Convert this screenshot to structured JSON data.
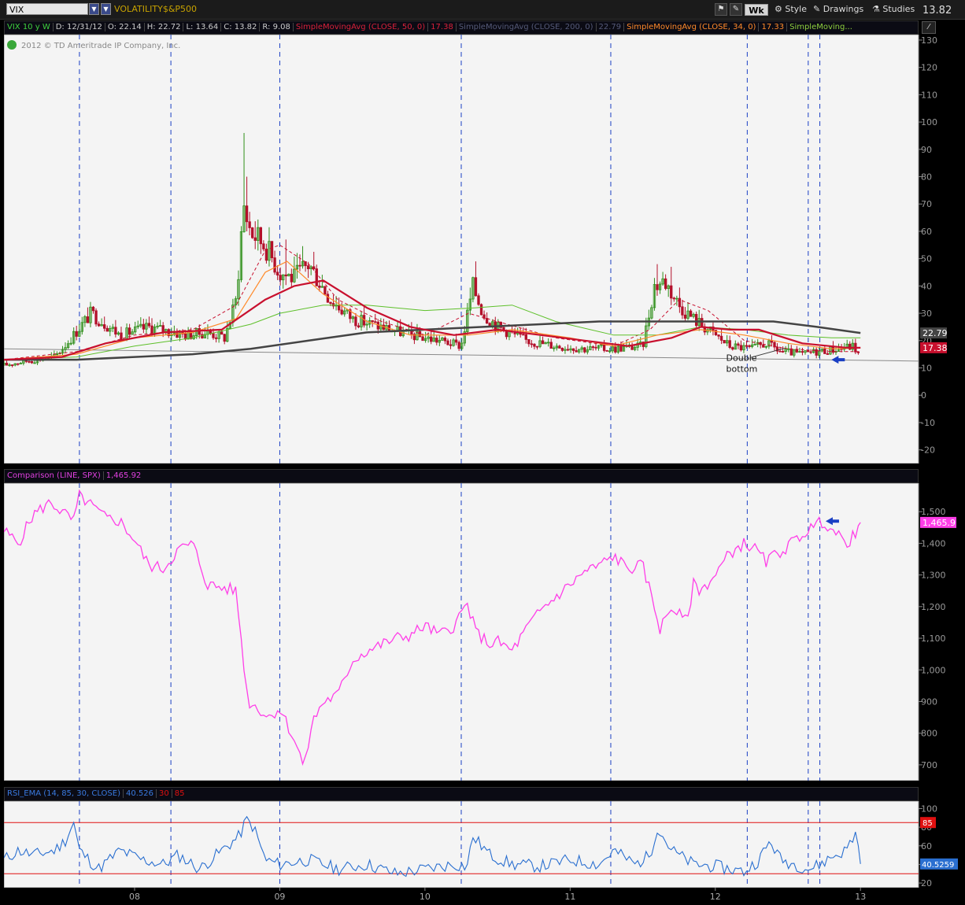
{
  "toolbar": {
    "symbol": "VIX",
    "title": "VOLATILITY$&P500",
    "timeframe": "Wk",
    "style_label": "Style",
    "drawings_label": "Drawings",
    "studies_label": "Studies",
    "last_price": "13.82"
  },
  "info": {
    "symbol_period": "VIX 10 y W",
    "date": "D: 12/31/12",
    "open": "O: 22.14",
    "high": "H: 22.72",
    "low": "L: 13.64",
    "close": "C: 13.82",
    "range": "R: 9.08",
    "sma50_label": "SimpleMovingAvg (CLOSE, 50, 0)",
    "sma50_val": "17.38",
    "sma200_label": "SimpleMovingAvg (CLOSE, 200, 0)",
    "sma200_val": "22.79",
    "sma34_label": "SimpleMovingAvg (CLOSE, 34, 0)",
    "sma34_val": "17.33",
    "sma_more_label": "SimpleMoving...",
    "copyright": "2012 © TD Ameritrade IP Company, Inc."
  },
  "colors": {
    "background": "#000000",
    "pane_bg": "#f4f4f4",
    "grid_vertical": "#1a3fc4",
    "candle_up": "#2f8f1a",
    "candle_down": "#b3102a",
    "sma50": "#c8102e",
    "sma200": "#444444",
    "sma34": "#ff8a2a",
    "sma_green": "#5ec02a",
    "spx_line": "#ff3ee8",
    "rsi_line": "#2a6fd0",
    "rsi_levels": "#e01010"
  },
  "chart_data": [
    {
      "type": "candlestick",
      "title": "VIX 10 y W",
      "ylim": [
        -25,
        132
      ],
      "yticks": [
        -20,
        -10,
        0,
        10,
        20,
        30,
        40,
        50,
        60,
        70,
        80,
        90,
        100,
        110,
        120,
        130
      ],
      "xlim": [
        2007.1,
        2013.4
      ],
      "xticks": [
        2008,
        2009,
        2010,
        2011,
        2012,
        2013
      ],
      "xtick_labels": [
        "08",
        "09",
        "10",
        "11",
        "12",
        "13"
      ],
      "vertical_lines": [
        2007.62,
        2008.25,
        2009.0,
        2010.25,
        2011.28,
        2012.22,
        2012.64,
        2012.72
      ],
      "last_labels": [
        {
          "value": 22.79,
          "text": "22.79",
          "color": "#444444"
        },
        {
          "value": 17.38,
          "text": "17.38",
          "color": "#c8102e"
        }
      ],
      "annotation": {
        "text_line1": "Double",
        "text_line2": "bottom",
        "x": 2012.4,
        "y": 12
      },
      "arrow": {
        "x": 2012.8,
        "y": 13
      },
      "trendline": {
        "x": [
          2007.1,
          2013.4
        ],
        "y": [
          17.0,
          12.5
        ]
      },
      "series_anchors": {
        "close": {
          "x": [
            2007.1,
            2007.25,
            2007.45,
            2007.55,
            2007.7,
            2007.9,
            2008.1,
            2008.35,
            2008.5,
            2008.62,
            2008.7,
            2008.75,
            2008.8,
            2008.9,
            2009.0,
            2009.1,
            2009.2,
            2009.35,
            2009.5,
            2009.7,
            2009.9,
            2010.1,
            2010.25,
            2010.33,
            2010.4,
            2010.5,
            2010.7,
            2010.9,
            2011.1,
            2011.3,
            2011.5,
            2011.58,
            2011.65,
            2011.75,
            2011.85,
            2011.95,
            2012.1,
            2012.25,
            2012.35,
            2012.45,
            2012.6,
            2012.7,
            2012.85,
            2012.95,
            2013.0
          ],
          "y": [
            11,
            12.5,
            14,
            20,
            30,
            22,
            25,
            22,
            23,
            21,
            35,
            70,
            60,
            55,
            45,
            43,
            48,
            35,
            28,
            25,
            22,
            20,
            18,
            40,
            30,
            25,
            20,
            18,
            17,
            17,
            18,
            40,
            42,
            33,
            28,
            24,
            18,
            17,
            19,
            16,
            15,
            16,
            17,
            18,
            14
          ]
        },
        "high": {
          "x": [
            2008.75,
            2008.77,
            2009.05,
            2010.35,
            2011.6,
            2011.7
          ],
          "y": [
            96,
            80,
            57,
            49,
            48,
            47
          ]
        },
        "sma50": {
          "x": [
            2007.1,
            2007.5,
            2007.8,
            2008.2,
            2008.6,
            2008.9,
            2009.1,
            2009.3,
            2009.6,
            2009.9,
            2010.2,
            2010.5,
            2010.8,
            2011.1,
            2011.4,
            2011.7,
            2011.9,
            2012.1,
            2012.3,
            2012.6,
            2012.9,
            2013.0
          ],
          "y": [
            13,
            14,
            19,
            23,
            24,
            35,
            40,
            42,
            32,
            25,
            22,
            24,
            22,
            20,
            18,
            21,
            25,
            24,
            24,
            19,
            17.4,
            17.38
          ]
        },
        "sma200": {
          "x": [
            2007.1,
            2007.6,
            2008.0,
            2008.4,
            2008.8,
            2009.2,
            2009.6,
            2010.0,
            2010.4,
            2010.8,
            2011.2,
            2011.6,
            2012.0,
            2012.4,
            2012.7,
            2013.0
          ],
          "y": [
            13,
            13,
            14,
            15,
            17,
            20,
            23,
            24,
            25,
            26,
            27,
            27,
            27,
            27,
            25,
            22.79
          ]
        },
        "sma34": {
          "x": [
            2007.1,
            2007.6,
            2008.0,
            2008.4,
            2008.7,
            2008.9,
            2009.05,
            2009.3,
            2009.6,
            2009.9,
            2010.3,
            2010.6,
            2011.0,
            2011.3,
            2011.6,
            2011.9,
            2012.2,
            2012.5,
            2012.8,
            2013.0
          ],
          "y": [
            13,
            15,
            21,
            23,
            28,
            45,
            49,
            37,
            27,
            22,
            22,
            24,
            21,
            18,
            22,
            24,
            22,
            19,
            17,
            17.33
          ]
        },
        "sma_green": {
          "x": [
            2007.1,
            2007.6,
            2008.0,
            2008.4,
            2008.8,
            2009.0,
            2009.3,
            2009.6,
            2010.0,
            2010.35,
            2010.6,
            2010.9,
            2011.3,
            2011.6,
            2011.9,
            2012.2,
            2012.5,
            2012.8,
            2013.0
          ],
          "y": [
            13,
            14,
            18,
            21,
            26,
            30,
            33,
            33,
            31,
            32,
            33,
            27,
            22,
            22,
            25,
            24,
            22,
            21,
            21
          ]
        },
        "sma_dashed": {
          "x": [
            2007.1,
            2007.6,
            2008.0,
            2008.4,
            2008.7,
            2008.9,
            2009.0,
            2009.2,
            2009.4,
            2009.7,
            2010.0,
            2010.3,
            2010.5,
            2010.9,
            2011.3,
            2011.55,
            2011.75,
            2011.95,
            2012.2,
            2012.5,
            2012.8,
            2013.0
          ],
          "y": [
            13,
            16,
            22,
            24,
            33,
            53,
            55,
            48,
            35,
            27,
            22,
            30,
            27,
            21,
            18,
            24,
            35,
            31,
            20,
            17,
            16,
            16
          ]
        }
      }
    },
    {
      "type": "line",
      "title": "Comparison (LINE, SPX)",
      "last_value": "1,465.92",
      "last_label": "1,465.9",
      "ylim": [
        650,
        1590
      ],
      "yticks": [
        700,
        800,
        900,
        1000,
        1100,
        1200,
        1300,
        1400,
        1500
      ],
      "ytick_labels": [
        "700",
        "800",
        "900",
        "1,000",
        "1,100",
        "1,200",
        "1,300",
        "1,400",
        "1,500"
      ],
      "arrow": {
        "x": 2012.76,
        "y": 1470
      },
      "series": [
        {
          "name": "SPX",
          "x": [
            2007.1,
            2007.2,
            2007.3,
            2007.42,
            2007.5,
            2007.58,
            2007.62,
            2007.7,
            2007.8,
            2007.9,
            2008.0,
            2008.1,
            2008.2,
            2008.3,
            2008.4,
            2008.5,
            2008.6,
            2008.7,
            2008.72,
            2008.78,
            2008.85,
            2008.92,
            2009.0,
            2009.1,
            2009.17,
            2009.22,
            2009.3,
            2009.4,
            2009.5,
            2009.6,
            2009.7,
            2009.8,
            2009.9,
            2010.0,
            2010.1,
            2010.2,
            2010.29,
            2010.35,
            2010.45,
            2010.5,
            2010.6,
            2010.7,
            2010.8,
            2010.9,
            2011.0,
            2011.1,
            2011.2,
            2011.3,
            2011.4,
            2011.5,
            2011.58,
            2011.62,
            2011.7,
            2011.8,
            2011.85,
            2011.9,
            2012.0,
            2012.1,
            2012.2,
            2012.28,
            2012.35,
            2012.4,
            2012.5,
            2012.6,
            2012.7,
            2012.75,
            2012.85,
            2012.9,
            2012.97,
            2013.0
          ],
          "y": [
            1440,
            1400,
            1490,
            1530,
            1500,
            1470,
            1550,
            1520,
            1480,
            1470,
            1410,
            1330,
            1320,
            1380,
            1400,
            1270,
            1260,
            1250,
            1160,
            900,
            880,
            850,
            880,
            780,
            690,
            830,
            900,
            920,
            1030,
            1060,
            1080,
            1100,
            1110,
            1140,
            1110,
            1140,
            1210,
            1120,
            1080,
            1090,
            1060,
            1130,
            1190,
            1230,
            1270,
            1310,
            1330,
            1360,
            1320,
            1330,
            1200,
            1130,
            1200,
            1150,
            1270,
            1250,
            1300,
            1370,
            1400,
            1380,
            1340,
            1360,
            1390,
            1430,
            1460,
            1470,
            1420,
            1400,
            1430,
            1466
          ]
        }
      ]
    },
    {
      "type": "line",
      "title": "RSI_EMA (14, 85, 30, CLOSE)",
      "value": "40.526",
      "value_label": "40.5259",
      "levels": [
        30,
        85
      ],
      "level_labels": [
        "30",
        "85"
      ],
      "ylim": [
        15,
        108
      ],
      "yticks": [
        20,
        40,
        60,
        80,
        100
      ],
      "series": [
        {
          "name": "RSI",
          "x": [
            2007.1,
            2007.2,
            2007.3,
            2007.45,
            2007.52,
            2007.58,
            2007.62,
            2007.75,
            2007.9,
            2008.05,
            2008.2,
            2008.3,
            2008.45,
            2008.6,
            2008.72,
            2008.77,
            2008.82,
            2008.9,
            2009.0,
            2009.2,
            2009.4,
            2009.6,
            2009.8,
            2010.0,
            2010.2,
            2010.29,
            2010.33,
            2010.45,
            2010.6,
            2010.8,
            2011.0,
            2011.2,
            2011.3,
            2011.45,
            2011.55,
            2011.6,
            2011.7,
            2011.85,
            2012.0,
            2012.1,
            2012.2,
            2012.3,
            2012.38,
            2012.45,
            2012.55,
            2012.65,
            2012.72,
            2012.8,
            2012.9,
            2012.97,
            2013.0
          ],
          "y": [
            45,
            55,
            50,
            55,
            65,
            85,
            55,
            35,
            55,
            45,
            40,
            50,
            35,
            55,
            70,
            88,
            80,
            45,
            40,
            45,
            35,
            40,
            30,
            35,
            40,
            38,
            70,
            50,
            40,
            38,
            45,
            40,
            55,
            40,
            50,
            80,
            55,
            40,
            38,
            35,
            32,
            45,
            65,
            45,
            40,
            35,
            40,
            48,
            55,
            75,
            40.5
          ]
        }
      ]
    }
  ]
}
